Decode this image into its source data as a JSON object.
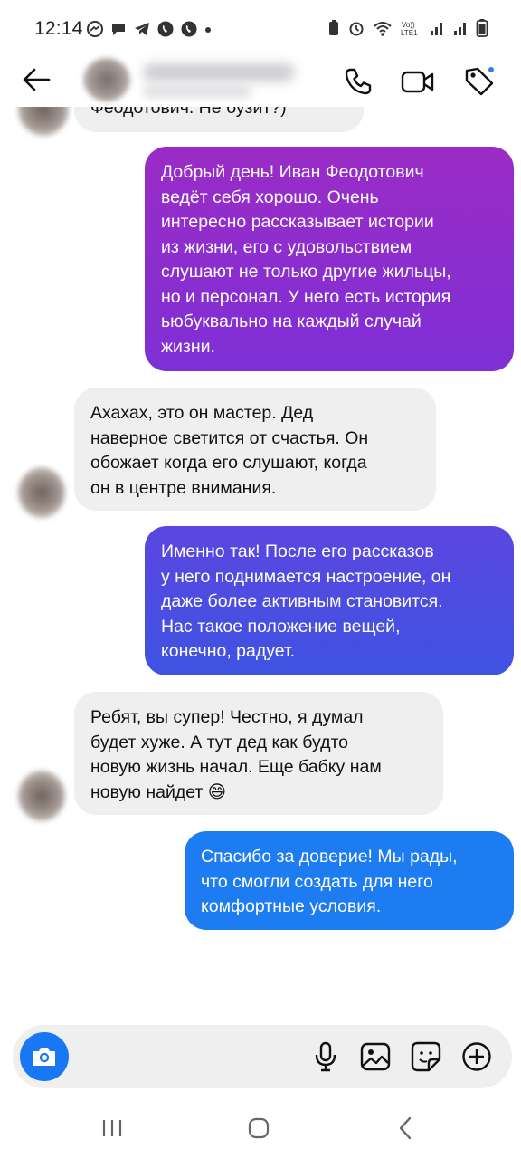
{
  "status_bar": {
    "time": "12:14",
    "left_icons": [
      "messenger-icon",
      "chat-icon",
      "telegram-icon",
      "viber-icon",
      "viber-icon",
      "dot-icon"
    ],
    "right_icons": [
      "battery-saver-icon",
      "alarm-icon",
      "wifi-icon",
      "volte-icon",
      "signal-icon",
      "signal-icon",
      "battery-icon"
    ],
    "volte_label": "Vo))\nLTE1"
  },
  "header": {
    "back_icon": "arrow-left-icon",
    "call_icon": "phone-icon",
    "video_icon": "video-camera-icon",
    "tag_icon": "tag-icon",
    "accent": "#2f7df6"
  },
  "messages": [
    {
      "sender": "contact",
      "text": "Феодотович. Не бузит?)",
      "partial": true
    },
    {
      "sender": "me",
      "text": "Добрый день! Иван Феодотович\nведёт себя хорошо. Очень\nинтересно рассказывает истории\nиз жизни, его с удовольствием\nслушают не только другие жильцы,\nно и персонал. У него есть история\nьюбуквально на каждый случай\nжизни.",
      "gradient": [
        "#9b2cc6",
        "#7e2fd6"
      ]
    },
    {
      "sender": "contact",
      "text": "Ахахах, это он мастер.   Дед\nнаверное светится от счастья. Он\nобожает когда его слушают, когда\nон в центре внимания."
    },
    {
      "sender": "me",
      "text": "Именно так! После его рассказов\nу него поднимается настроение, он\nдаже более активным становится.\nНас такое положение вещей,\nконечно, радует.",
      "gradient": [
        "#5946e0",
        "#3f53e2"
      ]
    },
    {
      "sender": "contact",
      "text": "Ребят, вы супер! Честно, я думал\nбудет хуже. А тут дед как будто\nновую жизнь начал. Еще бабку нам\nновую найдет 😄"
    },
    {
      "sender": "me",
      "text": "Спасибо за доверие! Мы рады,\nчто смогли создать для него\nкомфортные условия.",
      "gradient": [
        "#1d7cf2",
        "#1877f2"
      ]
    }
  ],
  "composer": {
    "camera_icon": "camera-icon",
    "placeholder": "",
    "mic_icon": "microphone-icon",
    "gallery_icon": "image-icon",
    "sticker_icon": "sticker-icon",
    "plus_icon": "plus-circle-icon",
    "accent": "#1877f2"
  },
  "nav_bar": {
    "recents_icon": "recents-icon",
    "home_icon": "home-icon",
    "back_icon": "chevron-left-icon"
  }
}
